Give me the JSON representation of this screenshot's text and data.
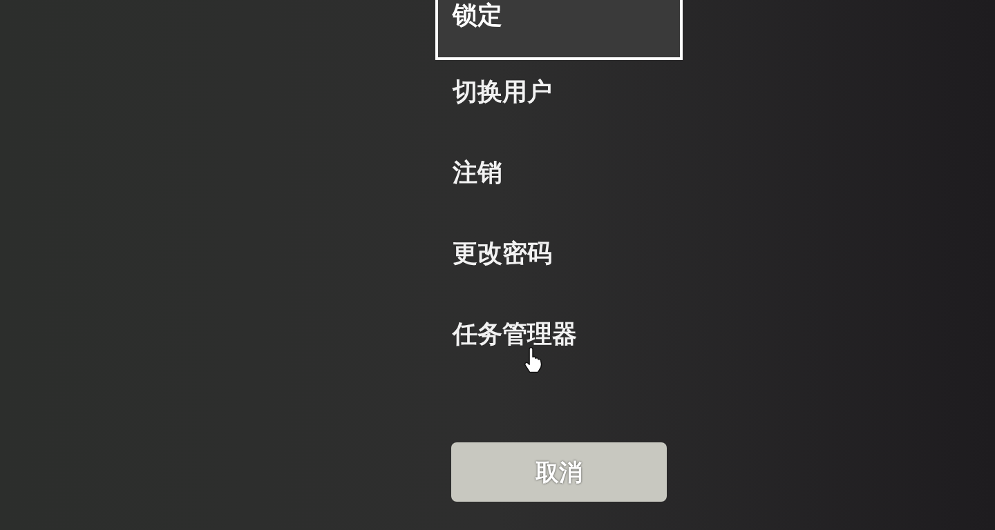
{
  "menu": {
    "items": [
      {
        "label": "锁定",
        "selected": true
      },
      {
        "label": "切换用户",
        "selected": false
      },
      {
        "label": "注销",
        "selected": false
      },
      {
        "label": "更改密码",
        "selected": false
      },
      {
        "label": "任务管理器",
        "selected": false
      }
    ]
  },
  "cancel_button": {
    "label": "取消"
  }
}
